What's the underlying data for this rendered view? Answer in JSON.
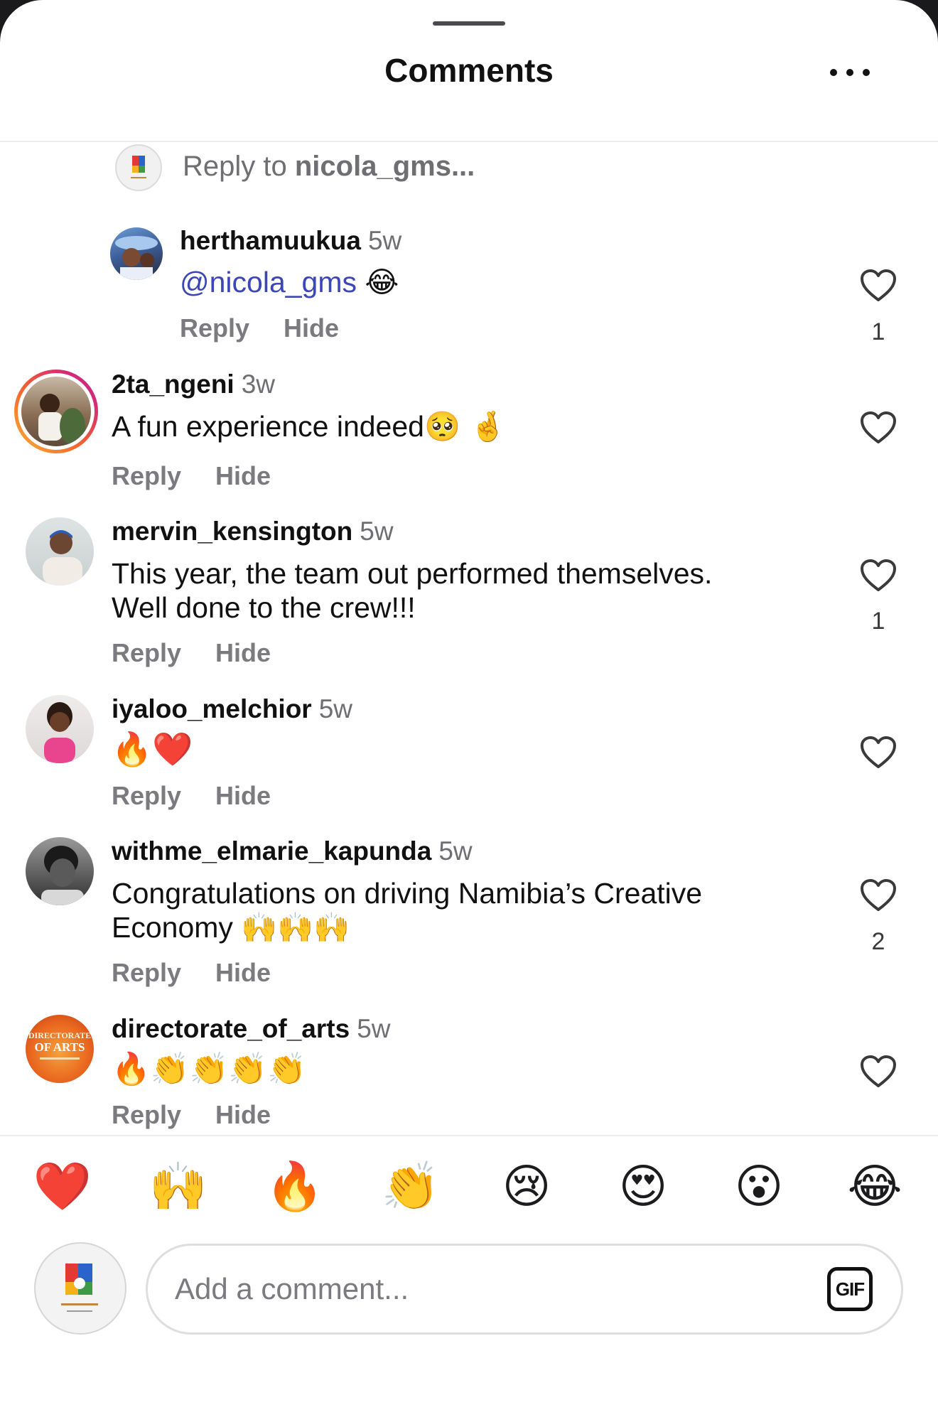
{
  "header": {
    "title": "Comments"
  },
  "reply_bar": {
    "prefix": "Reply to ",
    "target": "nicola_gms..."
  },
  "actions": {
    "reply_label": "Reply",
    "hide_label": "Hide"
  },
  "comments": [
    {
      "username": "herthamuukua",
      "time": "5w",
      "mention": "@nicola_gms",
      "text": "",
      "emoji": "😂",
      "likes": "1",
      "avatar_icon": "user-photo-icon"
    },
    {
      "username": "2ta_ngeni",
      "time": "3w",
      "text": "A fun experience indeed",
      "emoji": "🥺 🤞",
      "likes": "",
      "avatar_icon": "user-photo-icon"
    },
    {
      "username": "mervin_kensington",
      "time": "5w",
      "text_line1": "This year, the team out performed themselves.",
      "text_line2": "Well done to the crew!!!",
      "likes": "1",
      "avatar_icon": "user-photo-icon"
    },
    {
      "username": "iyaloo_melchior",
      "time": "5w",
      "emoji": "🔥❤️",
      "likes": "",
      "avatar_icon": "user-photo-icon"
    },
    {
      "username": "withme_elmarie_kapunda",
      "time": "5w",
      "text_line1": "Congratulations on driving Namibia’s Creative",
      "text_line2": "Economy",
      "emoji": "🙌🙌🙌",
      "likes": "2",
      "avatar_icon": "user-photo-icon"
    },
    {
      "username": "directorate_of_arts",
      "time": "5w",
      "emoji": "🔥👏👏👏👏",
      "likes": "",
      "avatar_text_line1": "DIRECTORATE",
      "avatar_text_line2": "OF ARTS"
    }
  ],
  "quick_reactions": [
    "❤️",
    "🙌",
    "🔥",
    "👏",
    "😢",
    "😍",
    "😮",
    "😂"
  ],
  "composer": {
    "placeholder": "Add a comment...",
    "gif_label": "GIF"
  },
  "colors": {
    "mention": "#3b46b8",
    "secondary_text": "#6e6e73",
    "story_ring_start": "#f9b233",
    "story_ring_end": "#d62976"
  }
}
